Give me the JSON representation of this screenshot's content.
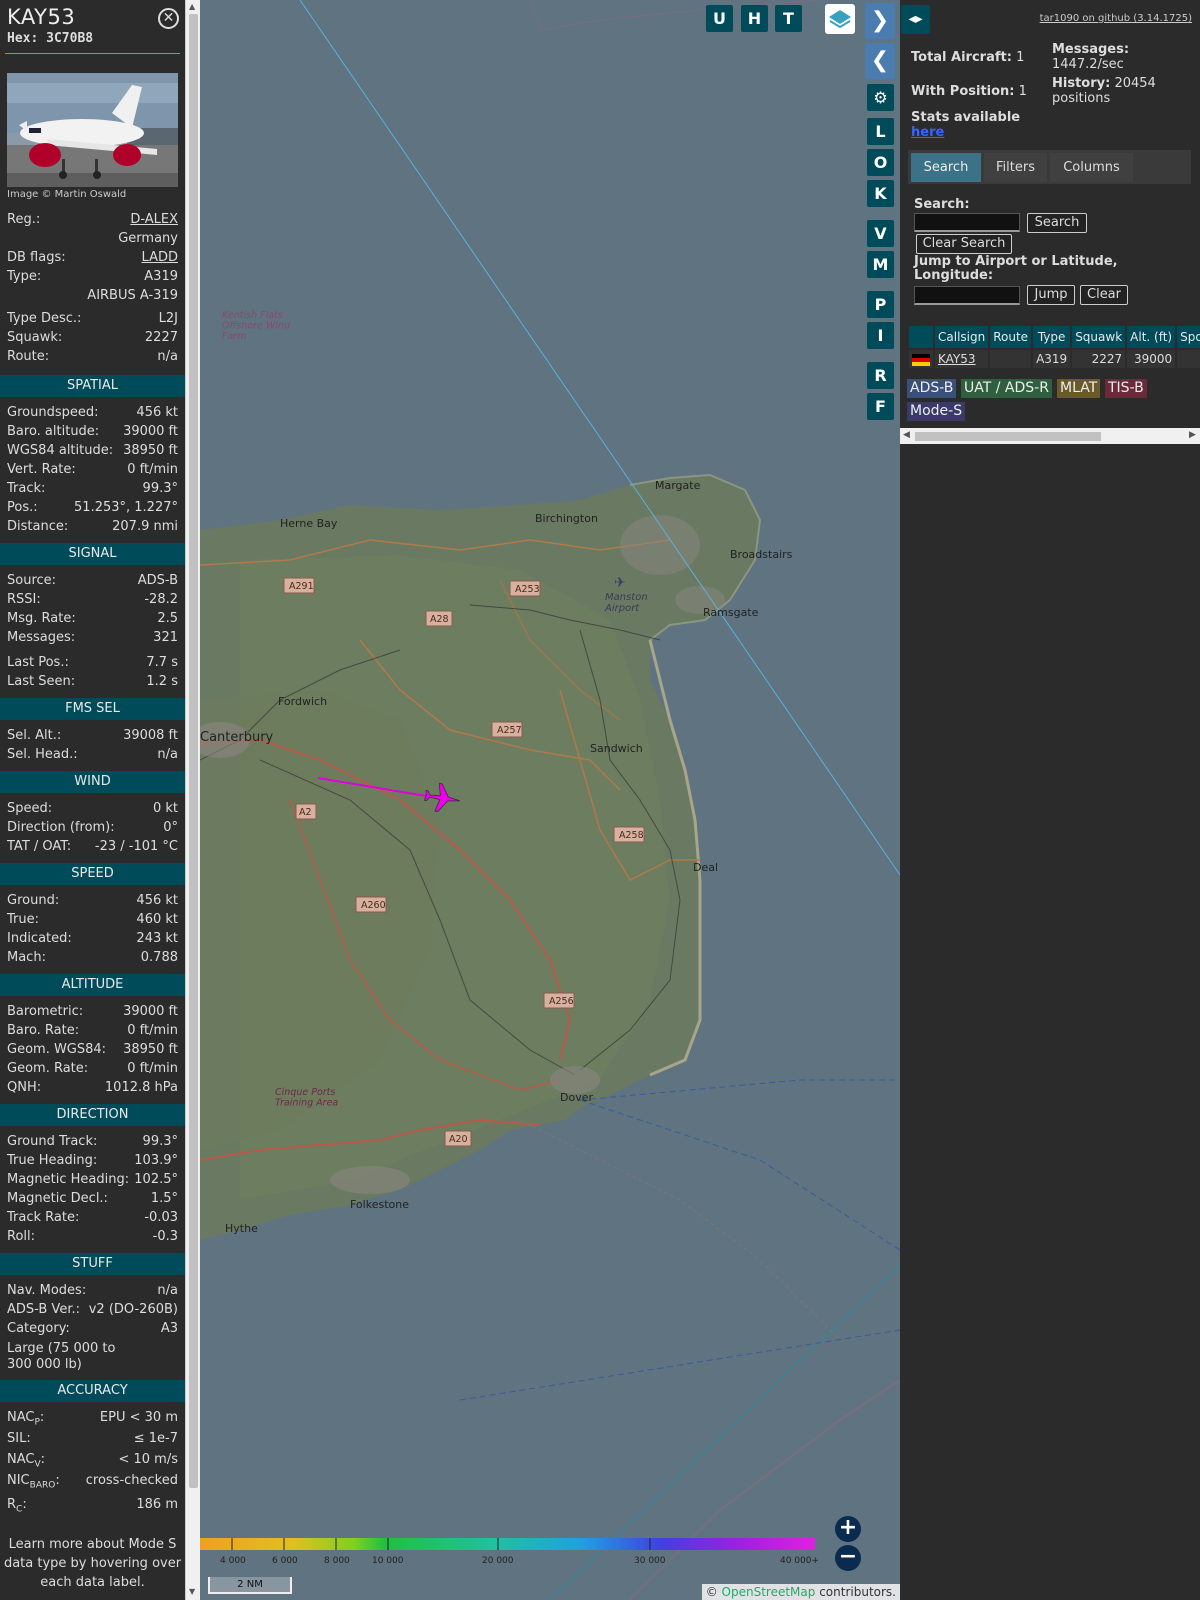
{
  "aircraft": {
    "callsign": "KAY53",
    "hex": "Hex: 3C70B8",
    "photo_credit": "Image © Martin Oswald"
  },
  "identity_rows": [
    {
      "k": "Reg.:",
      "v": "D-ALEX"
    },
    {
      "k": "",
      "v": "Germany"
    },
    {
      "k": "DB flags:",
      "v": "LADD"
    },
    {
      "k": "Type:",
      "v": "A319"
    },
    {
      "k": "",
      "v": "AIRBUS A-319"
    },
    {
      "k": "Type Desc.:",
      "v": "L2J"
    },
    {
      "k": "Squawk:",
      "v": "2227"
    },
    {
      "k": "Route:",
      "v": "n/a"
    }
  ],
  "sections": {
    "spatial": {
      "title": "SPATIAL",
      "rows": [
        {
          "k": "Groundspeed:",
          "v": "456 kt"
        },
        {
          "k": "Baro. altitude:",
          "v": "39000 ft"
        },
        {
          "k": "WGS84 altitude:",
          "v": "38950 ft"
        },
        {
          "k": "Vert. Rate:",
          "v": "0 ft/min"
        },
        {
          "k": "Track:",
          "v": "99.3°"
        },
        {
          "k": "Pos.:",
          "v": "51.253°, 1.227°"
        },
        {
          "k": "Distance:",
          "v": "207.9 nmi"
        }
      ]
    },
    "signal": {
      "title": "SIGNAL",
      "rows": [
        {
          "k": "Source:",
          "v": "ADS-B"
        },
        {
          "k": "RSSI:",
          "v": "-28.2"
        },
        {
          "k": "Msg. Rate:",
          "v": "2.5"
        },
        {
          "k": "Messages:",
          "v": "321"
        },
        {
          "k": "Last Pos.:",
          "v": "7.7 s"
        },
        {
          "k": "Last Seen:",
          "v": "1.2 s"
        }
      ]
    },
    "fms": {
      "title": "FMS SEL",
      "rows": [
        {
          "k": "Sel. Alt.:",
          "v": "39008 ft"
        },
        {
          "k": "Sel. Head.:",
          "v": "n/a"
        }
      ]
    },
    "wind": {
      "title": "WIND",
      "rows": [
        {
          "k": "Speed:",
          "v": "0 kt"
        },
        {
          "k": "Direction (from):",
          "v": "0°"
        },
        {
          "k": "TAT / OAT:",
          "v": "-23 / -101 °C"
        }
      ]
    },
    "speed": {
      "title": "SPEED",
      "rows": [
        {
          "k": "Ground:",
          "v": "456 kt"
        },
        {
          "k": "True:",
          "v": "460 kt"
        },
        {
          "k": "Indicated:",
          "v": "243 kt"
        },
        {
          "k": "Mach:",
          "v": "0.788"
        }
      ]
    },
    "altitude": {
      "title": "ALTITUDE",
      "rows": [
        {
          "k": "Barometric:",
          "v": "39000 ft"
        },
        {
          "k": "Baro. Rate:",
          "v": "0 ft/min"
        },
        {
          "k": "Geom. WGS84:",
          "v": "38950 ft"
        },
        {
          "k": "Geom. Rate:",
          "v": "0 ft/min"
        },
        {
          "k": "QNH:",
          "v": "1012.8 hPa"
        }
      ]
    },
    "direction": {
      "title": "DIRECTION",
      "rows": [
        {
          "k": "Ground Track:",
          "v": "99.3°"
        },
        {
          "k": "True Heading:",
          "v": "103.9°"
        },
        {
          "k": "Magnetic Heading:",
          "v": "102.5°"
        },
        {
          "k": "Magnetic Decl.:",
          "v": "1.5°"
        },
        {
          "k": "Track Rate:",
          "v": "-0.03"
        },
        {
          "k": "Roll:",
          "v": "-0.3"
        }
      ]
    },
    "stuff": {
      "title": "STUFF",
      "rows": [
        {
          "k": "Nav. Modes:",
          "v": "n/a"
        },
        {
          "k": "ADS-B Ver.:",
          "v": "v2 (DO-260B)"
        },
        {
          "k": "Category:",
          "v": "A3"
        },
        {
          "k": "Large (75 000 to 300 000 lb)",
          "v": ""
        }
      ]
    },
    "accuracy": {
      "title": "ACCURACY",
      "rows": [
        {
          "k": "NAC",
          "sub": "P",
          "v": "EPU < 30 m"
        },
        {
          "k": "SIL:",
          "sub": "",
          "v": "≤ 1e-7"
        },
        {
          "k": "NAC",
          "sub": "V",
          "v": "< 10 m/s"
        },
        {
          "k": "NIC",
          "sub": "BARO",
          "v": "cross-checked"
        },
        {
          "k": "R",
          "sub": "C",
          "v": "186 m"
        }
      ]
    }
  },
  "learn_more": "Learn more about Mode S data type by hovering over each data label.",
  "map": {
    "top_buttons": [
      "U",
      "H",
      "T"
    ],
    "side_buttons": [
      "L",
      "O",
      "K",
      "V",
      "M",
      "P",
      "I",
      "R",
      "F"
    ],
    "places": [
      "Margate",
      "Herne Bay",
      "Birchington",
      "Broadstairs",
      "Manston Airport",
      "Ramsgate",
      "Fordwich",
      "Canterbury",
      "Sandwich",
      "Deal",
      "Dover",
      "Folkestone",
      "Hythe",
      "Kentish Flats Offshore Wind Farm",
      "Cinque Ports Training Area"
    ],
    "roads": [
      "A291",
      "A253",
      "A28",
      "A257",
      "A2",
      "A258",
      "A260",
      "A256",
      "A20"
    ],
    "altitude_scale": [
      "4 000",
      "6 000",
      "8 000",
      "10 000",
      "20 000",
      "30 000",
      "40 000+"
    ],
    "scale_label": "2 NM",
    "attribution_prefix": "© ",
    "attribution_link": "OpenStreetMap",
    "attribution_suffix": " contributors."
  },
  "right": {
    "github": "tar1090 on github (3.14.1725)",
    "total_aircraft_label": "Total Aircraft:",
    "total_aircraft": "1",
    "with_position_label": "With Position:",
    "with_position": "1",
    "messages_label": "Messages:",
    "messages": "1447.2/sec",
    "history_label": "History:",
    "history": "20454 positions",
    "stats_label": "Stats available",
    "stats_link": "here",
    "tabs": [
      "Search",
      "Filters",
      "Columns"
    ],
    "search_label": "Search:",
    "search_button": "Search",
    "clear_search_button": "Clear Search",
    "jump_label": "Jump to Airport or Latitude, Longitude:",
    "jump_button": "Jump",
    "clear_button": "Clear",
    "table_headers": [
      "",
      "Callsign",
      "Route",
      "Type",
      "Squawk",
      "Alt. (ft)",
      "Spd."
    ],
    "table_rows": [
      {
        "callsign": "KAY53",
        "route": "",
        "type": "A319",
        "squawk": "2227",
        "alt": "39000",
        "spd": ""
      }
    ],
    "badges": [
      "ADS-B",
      "UAT / ADS-R",
      "MLAT",
      "TIS-B",
      "Mode-S"
    ]
  },
  "colors": {
    "section_header": "#004b5a",
    "track": "#dd00dd",
    "adsb": "#3a4f7a",
    "uat": "#2f5f3f",
    "mlat": "#6a5a2a",
    "tisb": "#6a2a3a",
    "modes": "#3a3a6a"
  }
}
